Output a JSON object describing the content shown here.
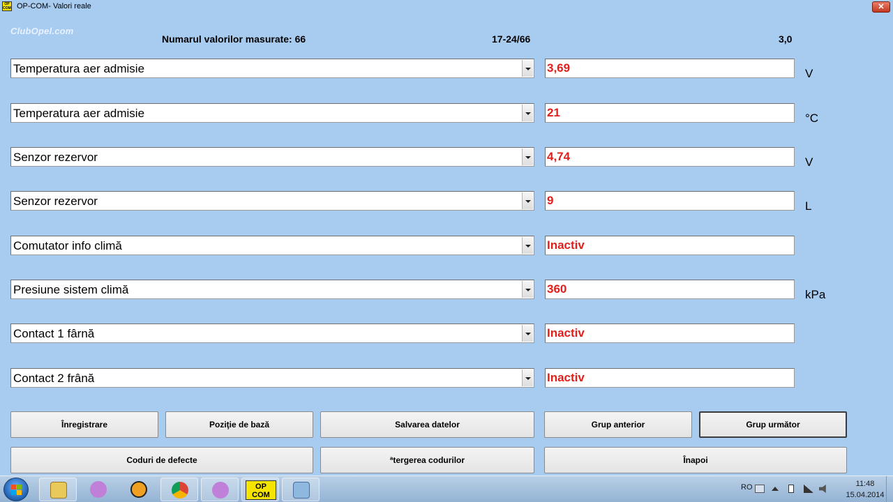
{
  "window": {
    "title": "OP-COM- Valori reale",
    "icon_text": "OP COM",
    "watermark": "ClubOpel.com",
    "close_label": "✕"
  },
  "header": {
    "count_label": "Numarul valorilor masurate: 66",
    "range": "17-24/66",
    "version": "3,0"
  },
  "rows": [
    {
      "param": "Temperatura aer admisie",
      "value": "3,69",
      "unit": "V"
    },
    {
      "param": "Temperatura aer admisie",
      "value": "21",
      "unit": "°C"
    },
    {
      "param": "Senzor rezervor",
      "value": "4,74",
      "unit": "V"
    },
    {
      "param": "Senzor rezervor",
      "value": "9",
      "unit": "L"
    },
    {
      "param": "Comutator info climă",
      "value": "Inactiv",
      "unit": ""
    },
    {
      "param": "Presiune sistem climă",
      "value": "360",
      "unit": "kPa"
    },
    {
      "param": "Contact 1 fârnă",
      "value": "Inactiv",
      "unit": ""
    },
    {
      "param": "Contact 2 frână",
      "value": "Inactiv",
      "unit": ""
    }
  ],
  "buttons": {
    "record": "Înregistrare",
    "base_position": "Poziţie de bază",
    "save_data": "Salvarea datelor",
    "prev_group": "Grup anterior",
    "next_group": "Grup următor",
    "fault_codes": "Coduri de defecte",
    "clear_codes": "ªtergerea codurilor",
    "back": "Înapoi"
  },
  "taskbar": {
    "apps": [
      {
        "icon": "explorer-icon",
        "color": "#e8c95a"
      },
      {
        "icon": "messenger-icon",
        "color": "#c07fd8"
      },
      {
        "icon": "avast-icon",
        "color": "#f0a020"
      },
      {
        "icon": "chrome-icon",
        "color": "#3aa04a"
      },
      {
        "icon": "messenger2-icon",
        "color": "#c07fd8"
      },
      {
        "icon": "opcom-icon",
        "color": "#f5e400",
        "label": "OP COM"
      },
      {
        "icon": "paint-icon",
        "color": "#8fb8e0"
      }
    ],
    "tray": {
      "language": "RO",
      "time": "11:48",
      "date": "15.04.2014"
    }
  },
  "colors": {
    "background": "#a8cbf0",
    "value_text": "#e0201c"
  }
}
